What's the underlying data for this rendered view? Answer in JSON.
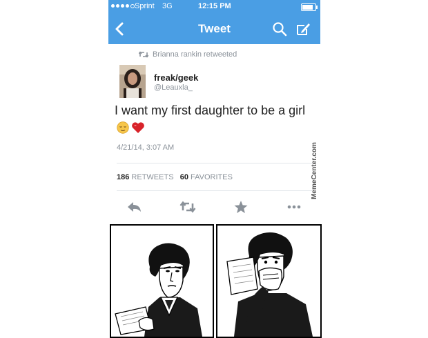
{
  "status_bar": {
    "carrier": "Sprint",
    "network": "3G",
    "time": "12:15 PM",
    "signal_bars_filled": 4,
    "signal_bars_total": 5,
    "battery_level": 0.85
  },
  "nav": {
    "title": "Tweet",
    "back_icon": "chevron-left-icon",
    "search_icon": "search-icon",
    "compose_icon": "compose-icon"
  },
  "tweet": {
    "retweeted_by": "Brianna rankin retweeted",
    "author_name": "freak/geek",
    "author_handle": "@Leauxla_",
    "text": "I want my first daughter to be a girl",
    "emojis": [
      "relieved-face-emoji",
      "red-heart-emoji"
    ],
    "date": "4/21/14, 3:07 AM",
    "retweets_count": "186",
    "retweets_label": "RETWEETS",
    "favorites_count": "60",
    "favorites_label": "FAVORITES"
  },
  "actions": [
    "reply-icon",
    "retweet-icon",
    "favorite-icon",
    "more-icon"
  ],
  "watermark": "MemeCenter.com",
  "colors": {
    "brand_blue": "#4a9ee4",
    "meta_gray": "#8a9199",
    "action_gray": "#8a9199"
  }
}
